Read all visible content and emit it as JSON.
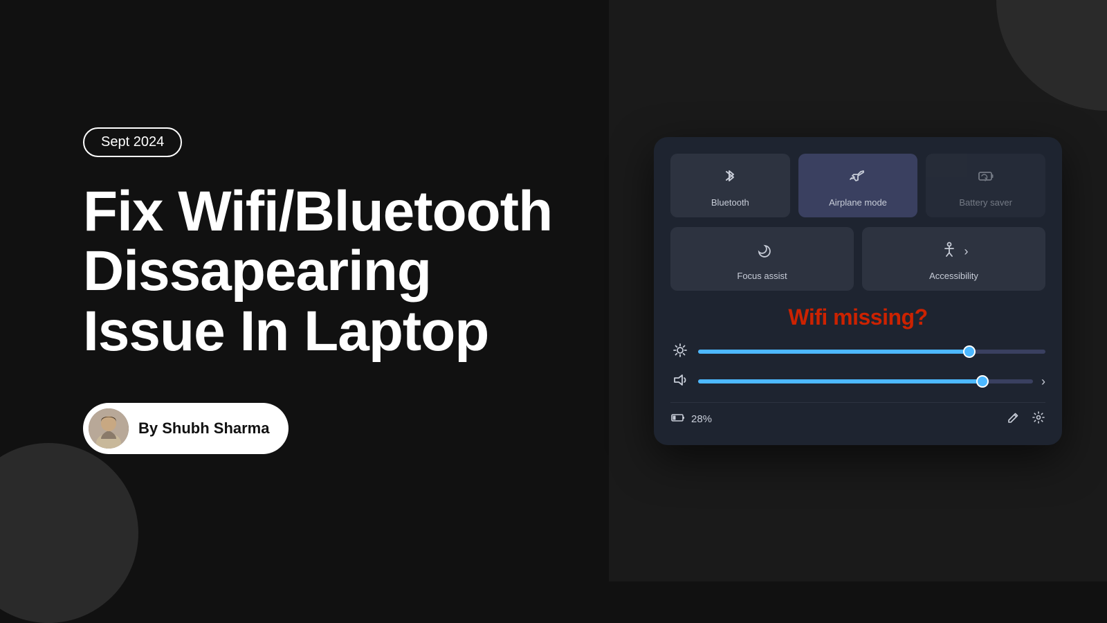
{
  "page": {
    "background": "#111"
  },
  "left": {
    "date_badge": "Sept 2024",
    "title_line1": "Fix Wifi/Bluetooth",
    "title_line2": "Dissapearing",
    "title_line3": "Issue In Laptop",
    "author_prefix": "By Shubh Sharma"
  },
  "right": {
    "tiles_row1": [
      {
        "label": "Bluetooth",
        "icon": "bluetooth"
      },
      {
        "label": "Airplane mode",
        "icon": "airplane"
      },
      {
        "label": "Battery saver",
        "icon": "battery"
      }
    ],
    "tiles_row2": [
      {
        "label": "Focus assist",
        "icon": "moon"
      },
      {
        "label": "Accessibility",
        "icon": "accessibility"
      }
    ],
    "wifi_missing_text": "Wifi missing?",
    "brightness_value": 78,
    "volume_value": 85,
    "battery_percent": "28%",
    "edit_icon": "edit",
    "settings_icon": "settings"
  }
}
